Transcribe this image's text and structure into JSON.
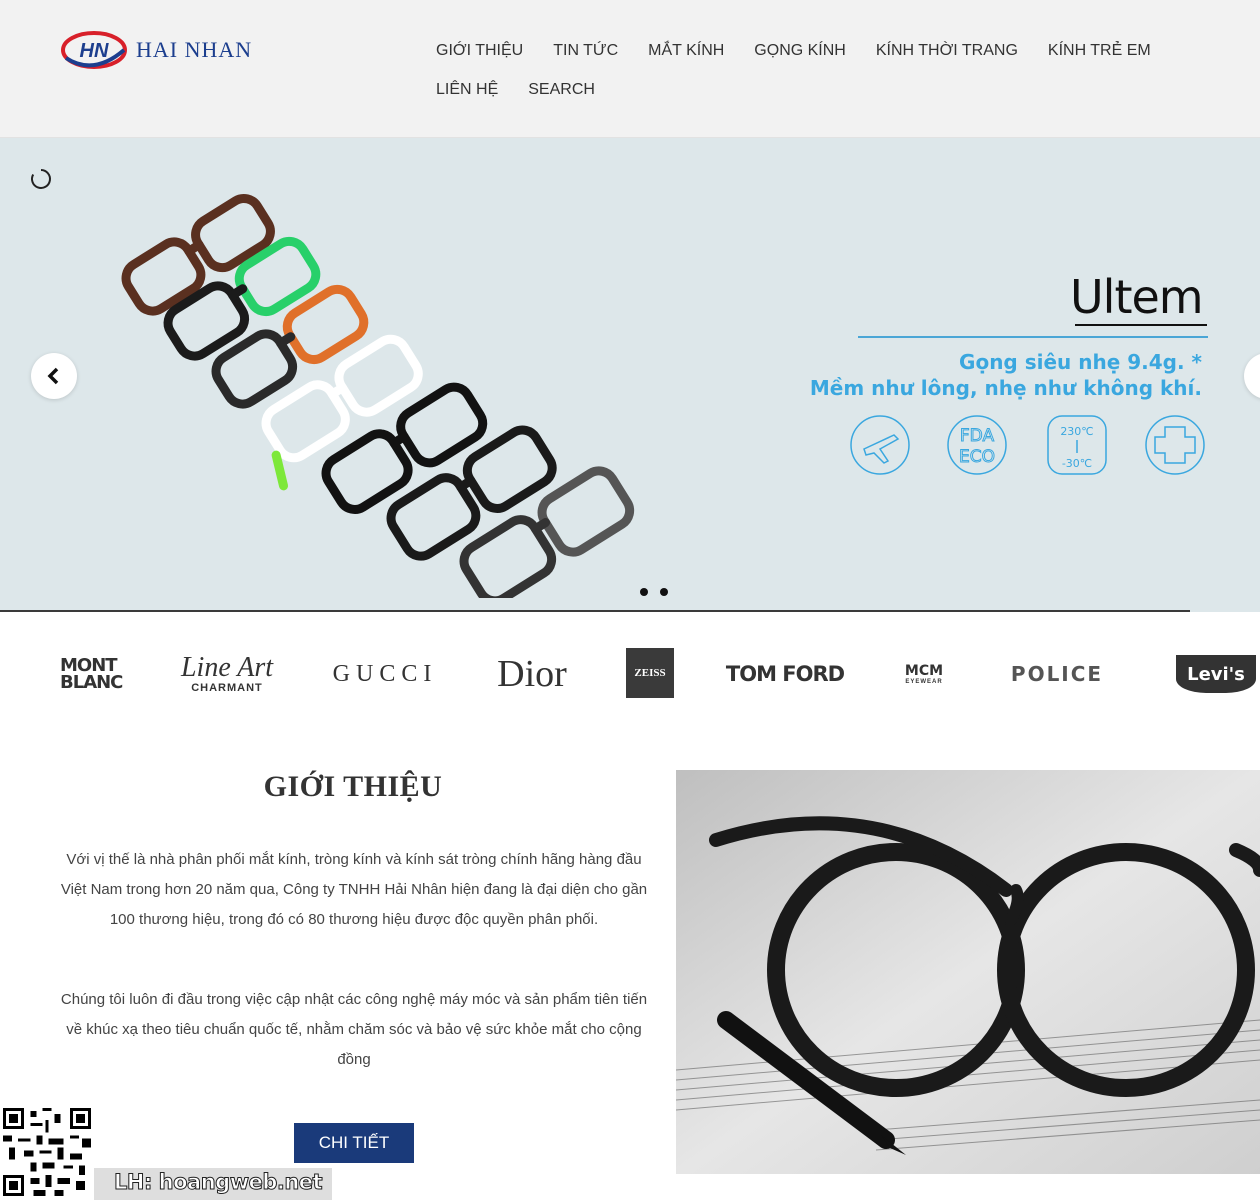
{
  "header": {
    "logo_text": "HAI NHAN",
    "logo_mark": "HN",
    "nav": [
      "GIỚI THIỆU",
      "TIN TỨC",
      "MẮT KÍNH",
      "GỌNG KÍNH",
      "KÍNH THỜI TRANG",
      "KÍNH TRẺ EM",
      "LIÊN HỆ",
      "SEARCH"
    ]
  },
  "slider": {
    "title": "Ultem",
    "tagline_1": "Gọng siêu nhẹ 9.4g. *",
    "tagline_2": "Mềm như lông, nhẹ như không khí.",
    "feature_icons": [
      "airplane-icon",
      "fda-eco-icon",
      "temperature-icon",
      "medical-cross-icon"
    ],
    "feature_fda": "FDA",
    "feature_eco": "ECO",
    "feature_temp_high": "230℃",
    "feature_temp_low": "-30℃",
    "dot_count": 2
  },
  "brands": [
    "MONT BLANC",
    "Line Art CHARMANT",
    "GUCCI",
    "Dior",
    "ZEISS",
    "TOM FORD",
    "MCM EYEWEAR",
    "POLICE",
    "Levi's"
  ],
  "brand_parts": {
    "montblanc_1": "MONT",
    "montblanc_2": "BLANC",
    "lineart": "Line Art",
    "charmant": "CHARMANT",
    "gucci": "GUCCI",
    "dior": "Dior",
    "zeiss": "ZEISS",
    "tomford": "TOM FORD",
    "mcm": "MCM",
    "mcm_sub": "EYEWEAR",
    "police": "POLICE",
    "levis": "Levi's"
  },
  "intro": {
    "title": "GIỚI THIỆU",
    "paragraph_1": "Với vị thế là nhà phân phối mắt kính, tròng kính và kính sát tròng chính hãng hàng đầu Việt Nam trong hơn 20 năm qua, Công ty TNHH Hải Nhân hiện đang là đại diện cho gần 100 thương hiệu, trong đó có 80 thương hiệu được độc quyền phân phối.",
    "paragraph_2": "Chúng tôi luôn đi đầu trong việc cập nhật các công nghệ máy móc và sản phẩm tiên tiến về khúc xạ theo tiêu chuẩn quốc tế, nhằm chăm sóc và bảo vệ sức khỏe mắt cho cộng đồng",
    "button": "CHI TIẾT"
  },
  "watermark": {
    "text": "LH: hoangweb.net"
  },
  "colors": {
    "brand_blue": "#1c3e8e",
    "logo_red": "#d8202a",
    "accent_cyan": "#3aa7df",
    "button_navy": "#1a3a7a",
    "header_bg": "#f2f2f2",
    "slider_bg": "#dde7ea"
  }
}
